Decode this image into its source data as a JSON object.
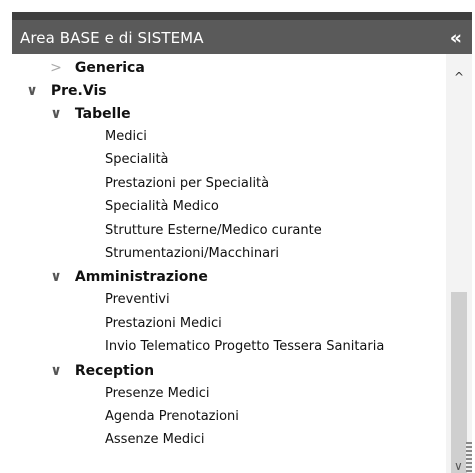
{
  "panel": {
    "title": "Area BASE e di SISTEMA",
    "collapse_label": "«"
  },
  "tree": {
    "items": [
      {
        "label": "Generica",
        "toggle": ">",
        "level": 1,
        "bold": true,
        "collapsed": true
      },
      {
        "label": "Pre.Vis",
        "toggle": "∨",
        "level": 0,
        "bold": true
      },
      {
        "label": "Tabelle",
        "toggle": "∨",
        "level": 1,
        "bold": true
      },
      {
        "label": "Medici",
        "level": 2
      },
      {
        "label": "Specialità",
        "level": 2
      },
      {
        "label": "Prestazioni per Specialità",
        "level": 2
      },
      {
        "label": "Specialità Medico",
        "level": 2
      },
      {
        "label": "Strutture Esterne/Medico curante",
        "level": 2
      },
      {
        "label": "Strumentazioni/Macchinari",
        "level": 2
      },
      {
        "label": "Amministrazione",
        "toggle": "∨",
        "level": 1,
        "bold": true
      },
      {
        "label": "Preventivi",
        "level": 2
      },
      {
        "label": "Prestazioni Medici",
        "level": 2
      },
      {
        "label": "Invio Telematico Progetto Tessera Sanitaria",
        "level": 2
      },
      {
        "label": "Reception",
        "toggle": "∨",
        "level": 1,
        "bold": true
      },
      {
        "label": "Presenze Medici",
        "level": 2
      },
      {
        "label": "Agenda Prenotazioni",
        "level": 2
      },
      {
        "label": "Assenze Medici",
        "level": 2
      }
    ]
  },
  "scrollbar": {
    "up_glyph": "^",
    "down_glyph": "∨"
  }
}
